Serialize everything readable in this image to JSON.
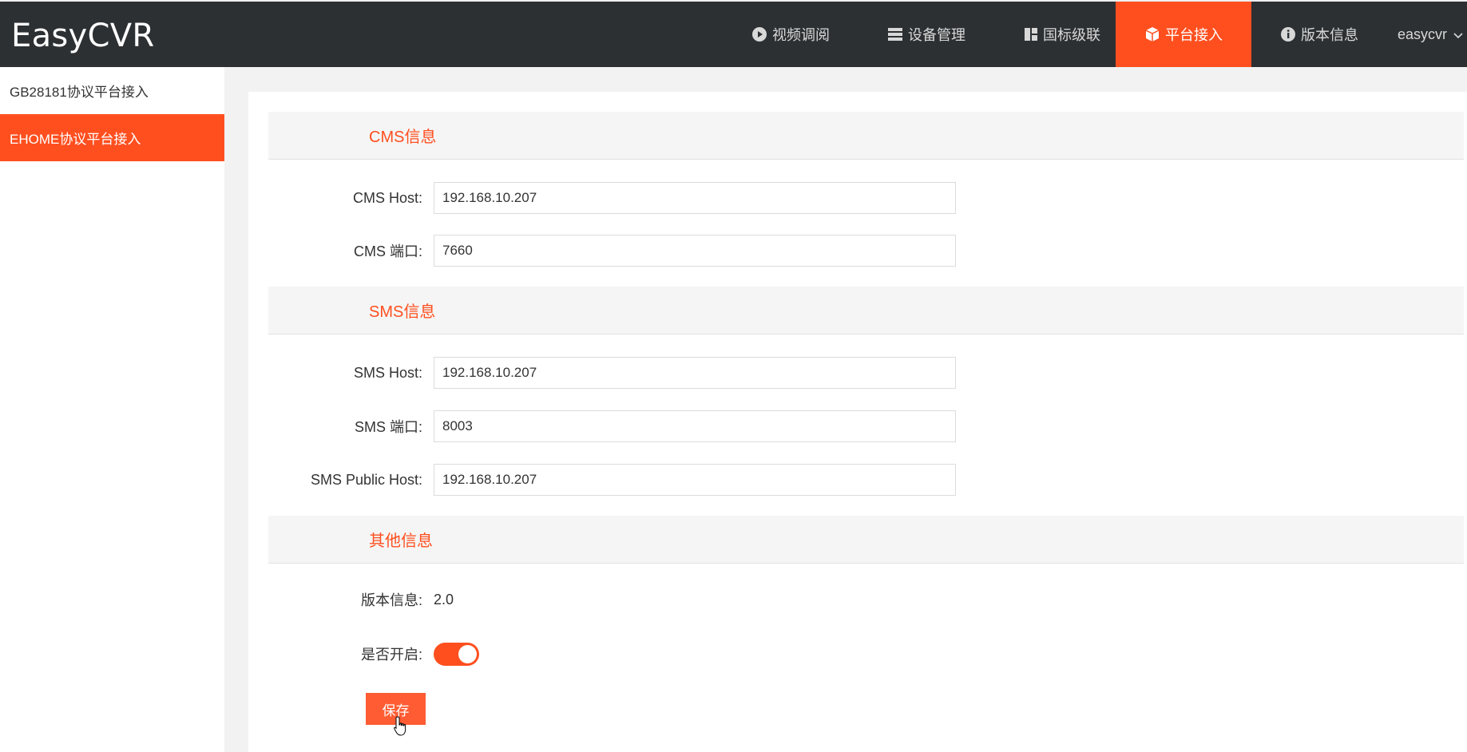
{
  "app": {
    "brand": "EasyCVR"
  },
  "nav": {
    "items": [
      {
        "label": "视频调阅",
        "icon": "play-circle-icon"
      },
      {
        "label": "设备管理",
        "icon": "server-icon"
      },
      {
        "label": "国标级联",
        "icon": "grid-icon"
      },
      {
        "label": "平台接入",
        "icon": "cube-icon",
        "active": true
      },
      {
        "label": "版本信息",
        "icon": "info-circle-icon"
      }
    ],
    "user": "easycvr"
  },
  "sidebar": {
    "items": [
      {
        "label": "GB28181协议平台接入"
      },
      {
        "label": "EHOME协议平台接入",
        "active": true
      }
    ]
  },
  "form": {
    "cms_section": "CMS信息",
    "cms_host_label": "CMS Host:",
    "cms_host_value": "192.168.10.207",
    "cms_port_label": "CMS 端口:",
    "cms_port_value": "7660",
    "sms_section": "SMS信息",
    "sms_host_label": "SMS Host:",
    "sms_host_value": "192.168.10.207",
    "sms_port_label": "SMS 端口:",
    "sms_port_value": "8003",
    "sms_public_host_label": "SMS Public Host:",
    "sms_public_host_value": "192.168.10.207",
    "other_section": "其他信息",
    "version_label": "版本信息:",
    "version_value": "2.0",
    "enabled_label": "是否开启:",
    "enabled": true,
    "save_label": "保存"
  },
  "colors": {
    "accent": "#ff4f1f",
    "topbar": "#2d3033"
  }
}
